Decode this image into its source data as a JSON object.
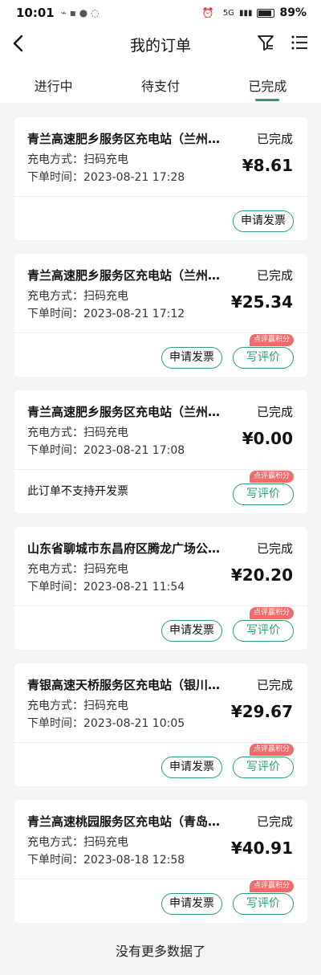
{
  "status_bar": {
    "time": "10:01",
    "battery": "89%",
    "signal_label": "5G"
  },
  "nav": {
    "title": "我的订单"
  },
  "tabs": [
    {
      "label": "进行中",
      "active": false
    },
    {
      "label": "待支付",
      "active": false
    },
    {
      "label": "已完成",
      "active": true
    }
  ],
  "labels": {
    "method_prefix": "充电方式：",
    "time_prefix": "下单时间：",
    "invoice_button": "申请发票",
    "review_button": "写评价",
    "review_badge": "点评赢积分",
    "no_invoice_note": "此订单不支持开发票"
  },
  "orders": [
    {
      "station": "青兰高速肥乡服务区充电站（兰州方向）",
      "status": "已完成",
      "method": "扫码充电",
      "time": "2023-08-21 17:28",
      "price": "¥8.61"
    },
    {
      "station": "青兰高速肥乡服务区充电站（兰州方向）",
      "status": "已完成",
      "method": "扫码充电",
      "time": "2023-08-21 17:12",
      "price": "¥25.34"
    },
    {
      "station": "青兰高速肥乡服务区充电站（兰州方向）",
      "status": "已完成",
      "method": "扫码充电",
      "time": "2023-08-21 17:08",
      "price": "¥0.00"
    },
    {
      "station": "山东省聊城市东昌府区腾龙广场公共充电站",
      "status": "已完成",
      "method": "扫码充电",
      "time": "2023-08-21 11:54",
      "price": "¥20.20"
    },
    {
      "station": "青银高速天桥服务区充电站（银川方向）",
      "status": "已完成",
      "method": "扫码充电",
      "time": "2023-08-21 10:05",
      "price": "¥29.67"
    },
    {
      "station": "青兰高速桃园服务区充电站（青岛方向）",
      "status": "已完成",
      "method": "扫码充电",
      "time": "2023-08-18 12:58",
      "price": "¥40.91"
    }
  ],
  "footer": {
    "text": "没有更多数据了"
  },
  "colors": {
    "accent": "#2a9d6d",
    "badge": "#f36a6a",
    "background": "#f3f4f6"
  }
}
